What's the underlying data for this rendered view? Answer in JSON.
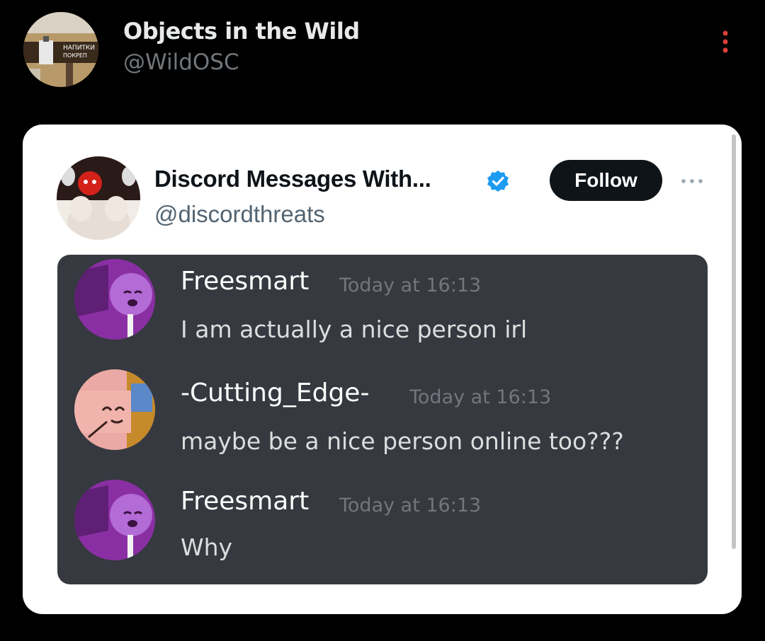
{
  "tweet": {
    "author_name": "Objects in the Wild",
    "author_handle": "@WildOSC",
    "avatar_sign_text": "НАПИТКИ ПОКРЕП",
    "more_icon": "more-vertical-icon"
  },
  "quoted": {
    "author_name": "Discord Messages With...",
    "author_handle": "@discordthreats",
    "verified_icon": "verified-badge-icon",
    "follow_label": "Follow",
    "more_icon": "more-horizontal-icon",
    "colors": {
      "follow_bg": "#0f1419",
      "verified": "#1d9bf0",
      "panel_bg": "#36393f"
    }
  },
  "discord": {
    "messages": [
      {
        "author": "Freesmart",
        "time": "Today at 16:13",
        "text": "I am actually a nice person irl",
        "avatar": "purple-lollipop-avatar"
      },
      {
        "author": "-Cutting_Edge-",
        "time": "Today at 16:13",
        "text": "maybe be a nice person online too???",
        "avatar": "pink-eraser-avatar"
      },
      {
        "author": "Freesmart",
        "time": "Today at 16:13",
        "text": "Why",
        "avatar": "purple-lollipop-avatar"
      }
    ]
  }
}
